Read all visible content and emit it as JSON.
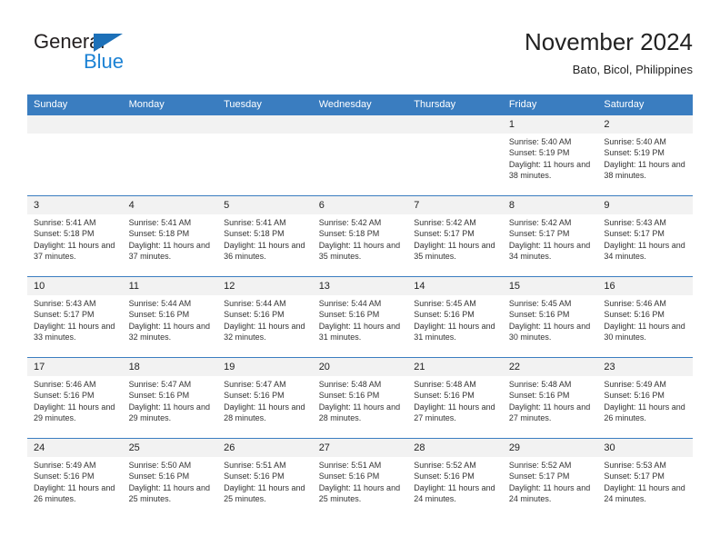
{
  "logo": {
    "word1": "General",
    "word2": "Blue",
    "triangle": "triangle-icon"
  },
  "header": {
    "title": "November 2024",
    "location": "Bato, Bicol, Philippines"
  },
  "colors": {
    "header_blue": "#3a7dc0",
    "logo_blue": "#1c82d4",
    "daynum_bg": "#f2f2f2"
  },
  "weekdays": [
    "Sunday",
    "Monday",
    "Tuesday",
    "Wednesday",
    "Thursday",
    "Friday",
    "Saturday"
  ],
  "labels": {
    "sunrise": "Sunrise:",
    "sunset": "Sunset:",
    "daylight": "Daylight:"
  },
  "weeks": [
    [
      {
        "day": "",
        "empty": true
      },
      {
        "day": "",
        "empty": true
      },
      {
        "day": "",
        "empty": true
      },
      {
        "day": "",
        "empty": true
      },
      {
        "day": "",
        "empty": true
      },
      {
        "day": "1",
        "sunrise": "Sunrise: 5:40 AM",
        "sunset": "Sunset: 5:19 PM",
        "daylight": "Daylight: 11 hours and 38 minutes."
      },
      {
        "day": "2",
        "sunrise": "Sunrise: 5:40 AM",
        "sunset": "Sunset: 5:19 PM",
        "daylight": "Daylight: 11 hours and 38 minutes."
      }
    ],
    [
      {
        "day": "3",
        "sunrise": "Sunrise: 5:41 AM",
        "sunset": "Sunset: 5:18 PM",
        "daylight": "Daylight: 11 hours and 37 minutes."
      },
      {
        "day": "4",
        "sunrise": "Sunrise: 5:41 AM",
        "sunset": "Sunset: 5:18 PM",
        "daylight": "Daylight: 11 hours and 37 minutes."
      },
      {
        "day": "5",
        "sunrise": "Sunrise: 5:41 AM",
        "sunset": "Sunset: 5:18 PM",
        "daylight": "Daylight: 11 hours and 36 minutes."
      },
      {
        "day": "6",
        "sunrise": "Sunrise: 5:42 AM",
        "sunset": "Sunset: 5:18 PM",
        "daylight": "Daylight: 11 hours and 35 minutes."
      },
      {
        "day": "7",
        "sunrise": "Sunrise: 5:42 AM",
        "sunset": "Sunset: 5:17 PM",
        "daylight": "Daylight: 11 hours and 35 minutes."
      },
      {
        "day": "8",
        "sunrise": "Sunrise: 5:42 AM",
        "sunset": "Sunset: 5:17 PM",
        "daylight": "Daylight: 11 hours and 34 minutes."
      },
      {
        "day": "9",
        "sunrise": "Sunrise: 5:43 AM",
        "sunset": "Sunset: 5:17 PM",
        "daylight": "Daylight: 11 hours and 34 minutes."
      }
    ],
    [
      {
        "day": "10",
        "sunrise": "Sunrise: 5:43 AM",
        "sunset": "Sunset: 5:17 PM",
        "daylight": "Daylight: 11 hours and 33 minutes."
      },
      {
        "day": "11",
        "sunrise": "Sunrise: 5:44 AM",
        "sunset": "Sunset: 5:16 PM",
        "daylight": "Daylight: 11 hours and 32 minutes."
      },
      {
        "day": "12",
        "sunrise": "Sunrise: 5:44 AM",
        "sunset": "Sunset: 5:16 PM",
        "daylight": "Daylight: 11 hours and 32 minutes."
      },
      {
        "day": "13",
        "sunrise": "Sunrise: 5:44 AM",
        "sunset": "Sunset: 5:16 PM",
        "daylight": "Daylight: 11 hours and 31 minutes."
      },
      {
        "day": "14",
        "sunrise": "Sunrise: 5:45 AM",
        "sunset": "Sunset: 5:16 PM",
        "daylight": "Daylight: 11 hours and 31 minutes."
      },
      {
        "day": "15",
        "sunrise": "Sunrise: 5:45 AM",
        "sunset": "Sunset: 5:16 PM",
        "daylight": "Daylight: 11 hours and 30 minutes."
      },
      {
        "day": "16",
        "sunrise": "Sunrise: 5:46 AM",
        "sunset": "Sunset: 5:16 PM",
        "daylight": "Daylight: 11 hours and 30 minutes."
      }
    ],
    [
      {
        "day": "17",
        "sunrise": "Sunrise: 5:46 AM",
        "sunset": "Sunset: 5:16 PM",
        "daylight": "Daylight: 11 hours and 29 minutes."
      },
      {
        "day": "18",
        "sunrise": "Sunrise: 5:47 AM",
        "sunset": "Sunset: 5:16 PM",
        "daylight": "Daylight: 11 hours and 29 minutes."
      },
      {
        "day": "19",
        "sunrise": "Sunrise: 5:47 AM",
        "sunset": "Sunset: 5:16 PM",
        "daylight": "Daylight: 11 hours and 28 minutes."
      },
      {
        "day": "20",
        "sunrise": "Sunrise: 5:48 AM",
        "sunset": "Sunset: 5:16 PM",
        "daylight": "Daylight: 11 hours and 28 minutes."
      },
      {
        "day": "21",
        "sunrise": "Sunrise: 5:48 AM",
        "sunset": "Sunset: 5:16 PM",
        "daylight": "Daylight: 11 hours and 27 minutes."
      },
      {
        "day": "22",
        "sunrise": "Sunrise: 5:48 AM",
        "sunset": "Sunset: 5:16 PM",
        "daylight": "Daylight: 11 hours and 27 minutes."
      },
      {
        "day": "23",
        "sunrise": "Sunrise: 5:49 AM",
        "sunset": "Sunset: 5:16 PM",
        "daylight": "Daylight: 11 hours and 26 minutes."
      }
    ],
    [
      {
        "day": "24",
        "sunrise": "Sunrise: 5:49 AM",
        "sunset": "Sunset: 5:16 PM",
        "daylight": "Daylight: 11 hours and 26 minutes."
      },
      {
        "day": "25",
        "sunrise": "Sunrise: 5:50 AM",
        "sunset": "Sunset: 5:16 PM",
        "daylight": "Daylight: 11 hours and 25 minutes."
      },
      {
        "day": "26",
        "sunrise": "Sunrise: 5:51 AM",
        "sunset": "Sunset: 5:16 PM",
        "daylight": "Daylight: 11 hours and 25 minutes."
      },
      {
        "day": "27",
        "sunrise": "Sunrise: 5:51 AM",
        "sunset": "Sunset: 5:16 PM",
        "daylight": "Daylight: 11 hours and 25 minutes."
      },
      {
        "day": "28",
        "sunrise": "Sunrise: 5:52 AM",
        "sunset": "Sunset: 5:16 PM",
        "daylight": "Daylight: 11 hours and 24 minutes."
      },
      {
        "day": "29",
        "sunrise": "Sunrise: 5:52 AM",
        "sunset": "Sunset: 5:17 PM",
        "daylight": "Daylight: 11 hours and 24 minutes."
      },
      {
        "day": "30",
        "sunrise": "Sunrise: 5:53 AM",
        "sunset": "Sunset: 5:17 PM",
        "daylight": "Daylight: 11 hours and 24 minutes."
      }
    ]
  ]
}
